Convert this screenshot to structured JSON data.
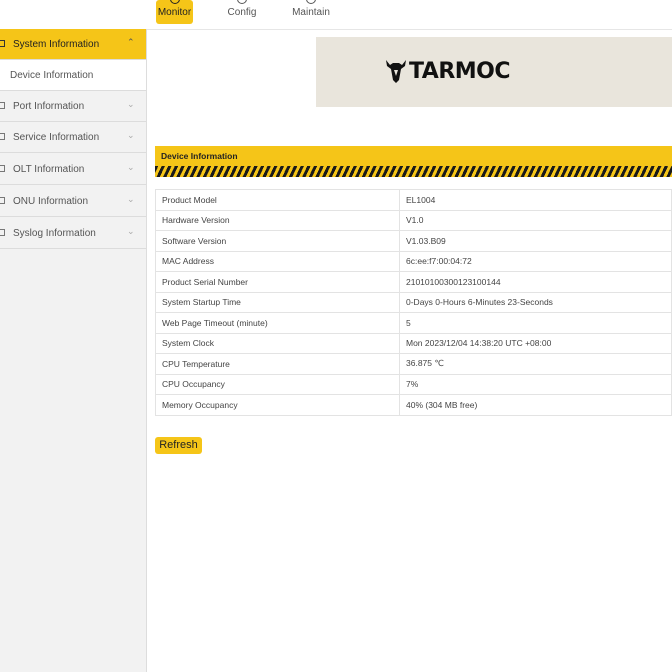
{
  "topnav": {
    "items": [
      {
        "label": "Monitor",
        "icon": "monitor-icon",
        "active": true
      },
      {
        "label": "Config",
        "icon": "gear-icon"
      },
      {
        "label": "Maintain",
        "icon": "wrench-icon"
      }
    ]
  },
  "sidebar": {
    "items": [
      {
        "label": "System Information",
        "active": true
      },
      {
        "label": "Device Information"
      },
      {
        "label": "Port Information"
      },
      {
        "label": "Service Information"
      },
      {
        "label": "OLT Information"
      },
      {
        "label": "ONU Information"
      },
      {
        "label": "Syslog Information"
      }
    ]
  },
  "brand": {
    "name": "TARMOC"
  },
  "panel": {
    "title": "Device Information"
  },
  "device": {
    "rows": [
      {
        "key": "Product Model",
        "value": "EL1004"
      },
      {
        "key": "Hardware Version",
        "value": "V1.0"
      },
      {
        "key": "Software Version",
        "value": "V1.03.B09"
      },
      {
        "key": "MAC Address",
        "value": "6c:ee:f7:00:04:72"
      },
      {
        "key": "Product Serial Number",
        "value": "21010100300123100144"
      },
      {
        "key": "System Startup Time",
        "value": "0-Days 0-Hours 6-Minutes 23-Seconds"
      },
      {
        "key": "Web Page Timeout (minute)",
        "value": "5"
      },
      {
        "key": "System Clock",
        "value": "Mon 2023/12/04 14:38:20 UTC +08:00"
      },
      {
        "key": "CPU Temperature",
        "value": "36.875 ℃"
      },
      {
        "key": "CPU Occupancy",
        "value": "7%"
      },
      {
        "key": "Memory Occupancy",
        "value": "40% (304 MB free)"
      }
    ]
  },
  "actions": {
    "refresh_label": "Refresh"
  },
  "colors": {
    "accent": "#f5c518",
    "sidebar_bg": "#f2f2f2",
    "banner_bg": "#e9e5dc"
  }
}
